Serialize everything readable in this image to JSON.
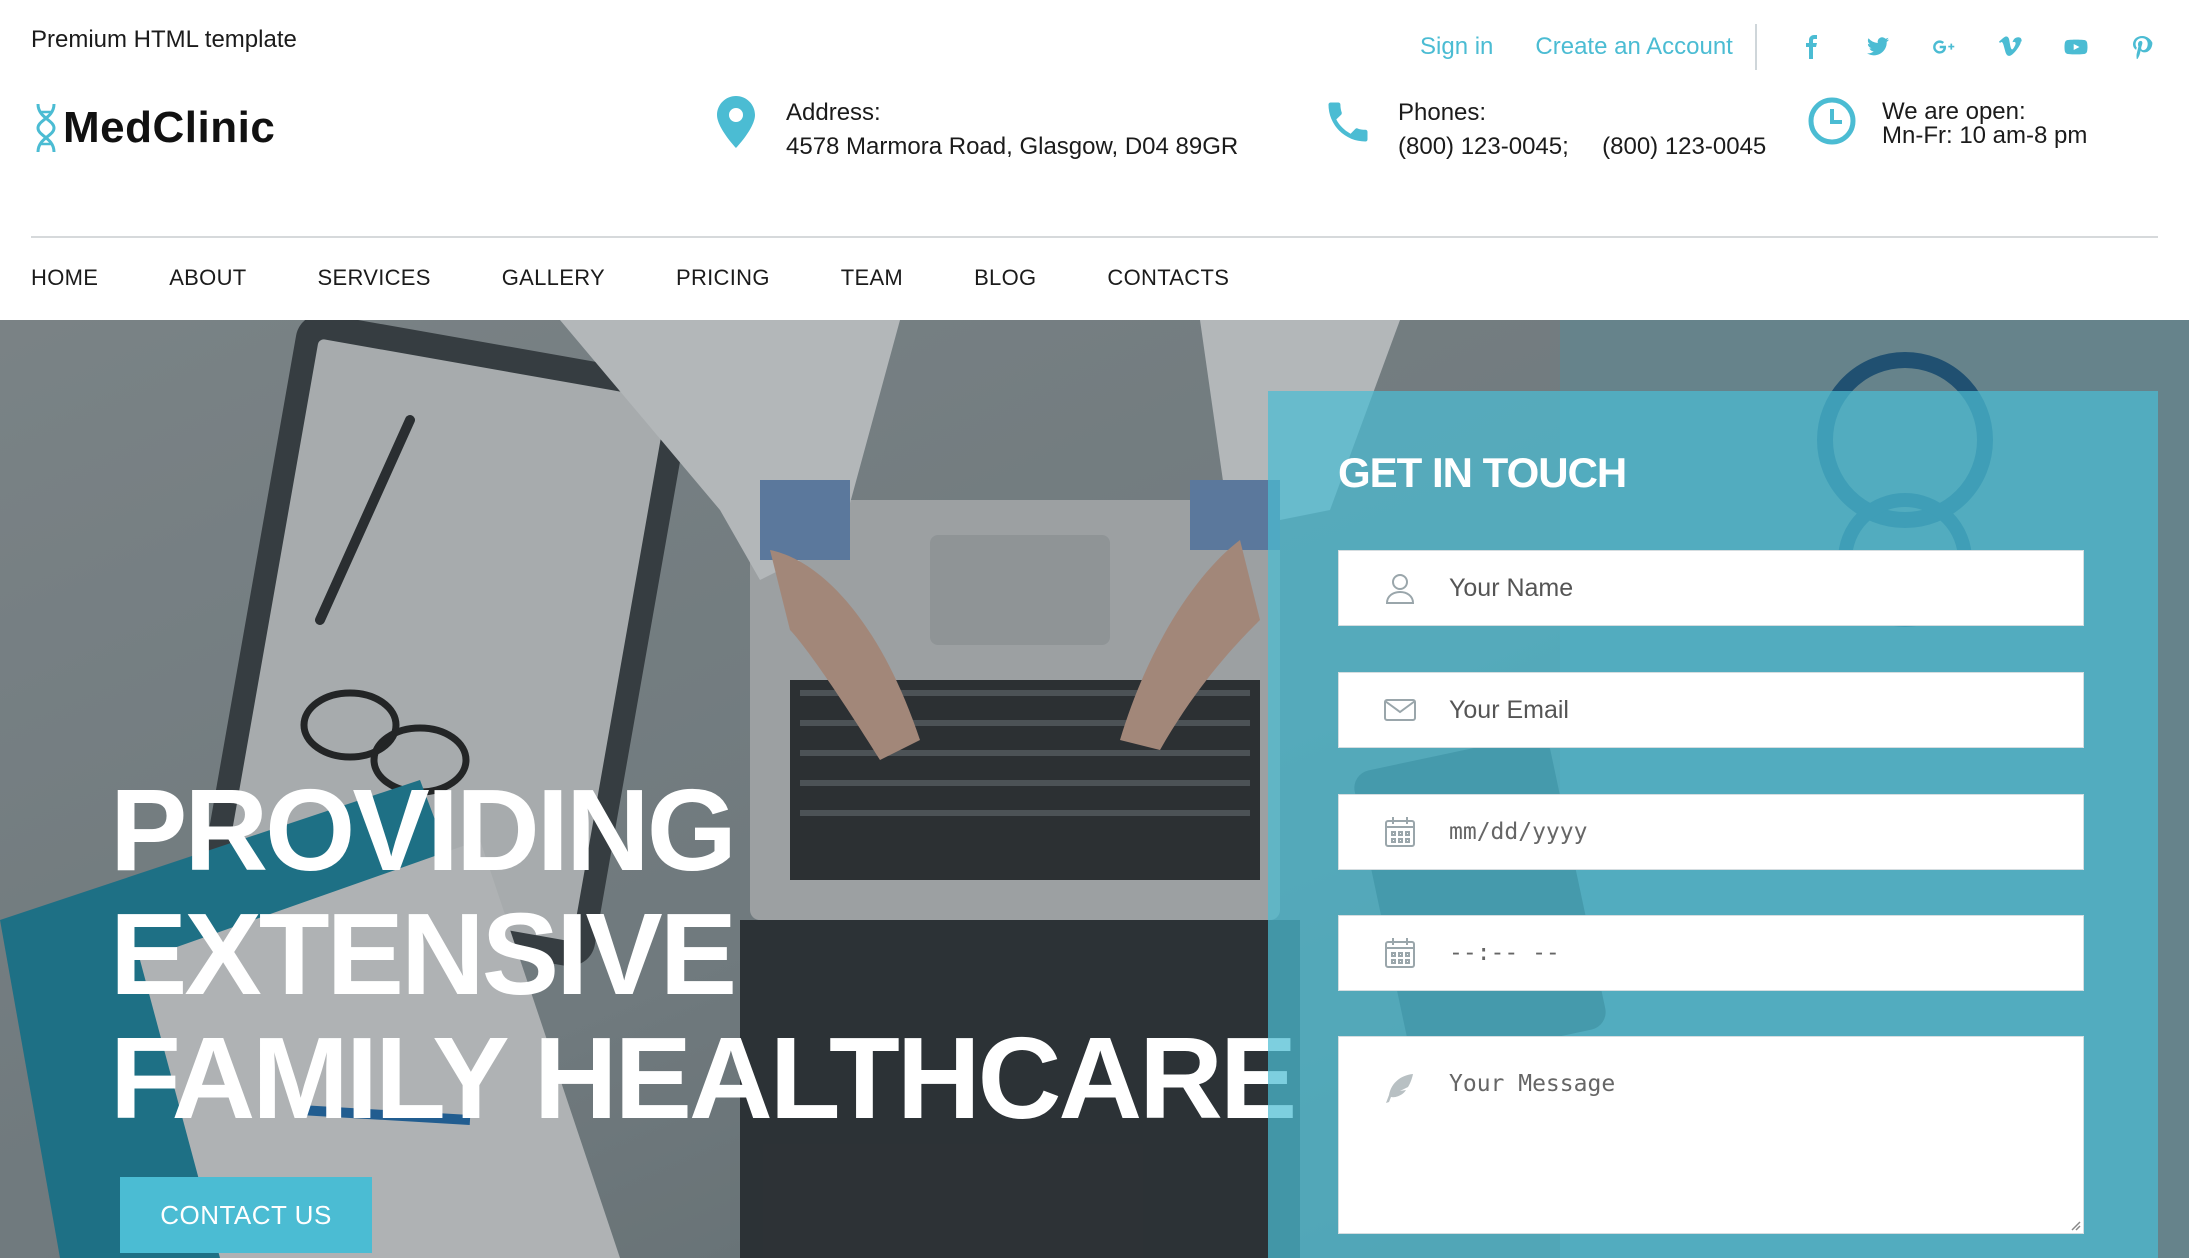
{
  "header": {
    "tagline": "Premium HTML template",
    "sign_in": "Sign in",
    "create_account": "Create an Account",
    "social": [
      "facebook-icon",
      "twitter-icon",
      "google-plus-icon",
      "vimeo-icon",
      "youtube-icon",
      "pinterest-icon"
    ],
    "logo": "MedClinic",
    "address": {
      "label": "Address:",
      "value": "4578 Marmora Road, Glasgow, D04 89GR"
    },
    "phones": {
      "label": "Phones:",
      "value1": "(800) 123-0045;",
      "value2": "(800) 123-0045"
    },
    "hours": {
      "label": "We are open:",
      "value": "Mn-Fr: 10 am-8 pm"
    }
  },
  "nav": [
    "HOME",
    "ABOUT",
    "SERVICES",
    "GALLERY",
    "PRICING",
    "TEAM",
    "BLOG",
    "CONTACTS"
  ],
  "hero": {
    "title_lines": [
      "PROVIDING",
      "EXTENSIVE",
      "FAMILY HEALTHCARE"
    ],
    "cta": "CONTACT US"
  },
  "form": {
    "title": "GET IN TOUCH",
    "name_placeholder": "Your Name",
    "email_placeholder": "Your Email",
    "date_placeholder": "mm/dd/yyyy",
    "time_placeholder": "--:-- --",
    "message_placeholder": "Your Message"
  },
  "colors": {
    "accent": "#4bbcd3",
    "text": "#1b1b1b"
  }
}
